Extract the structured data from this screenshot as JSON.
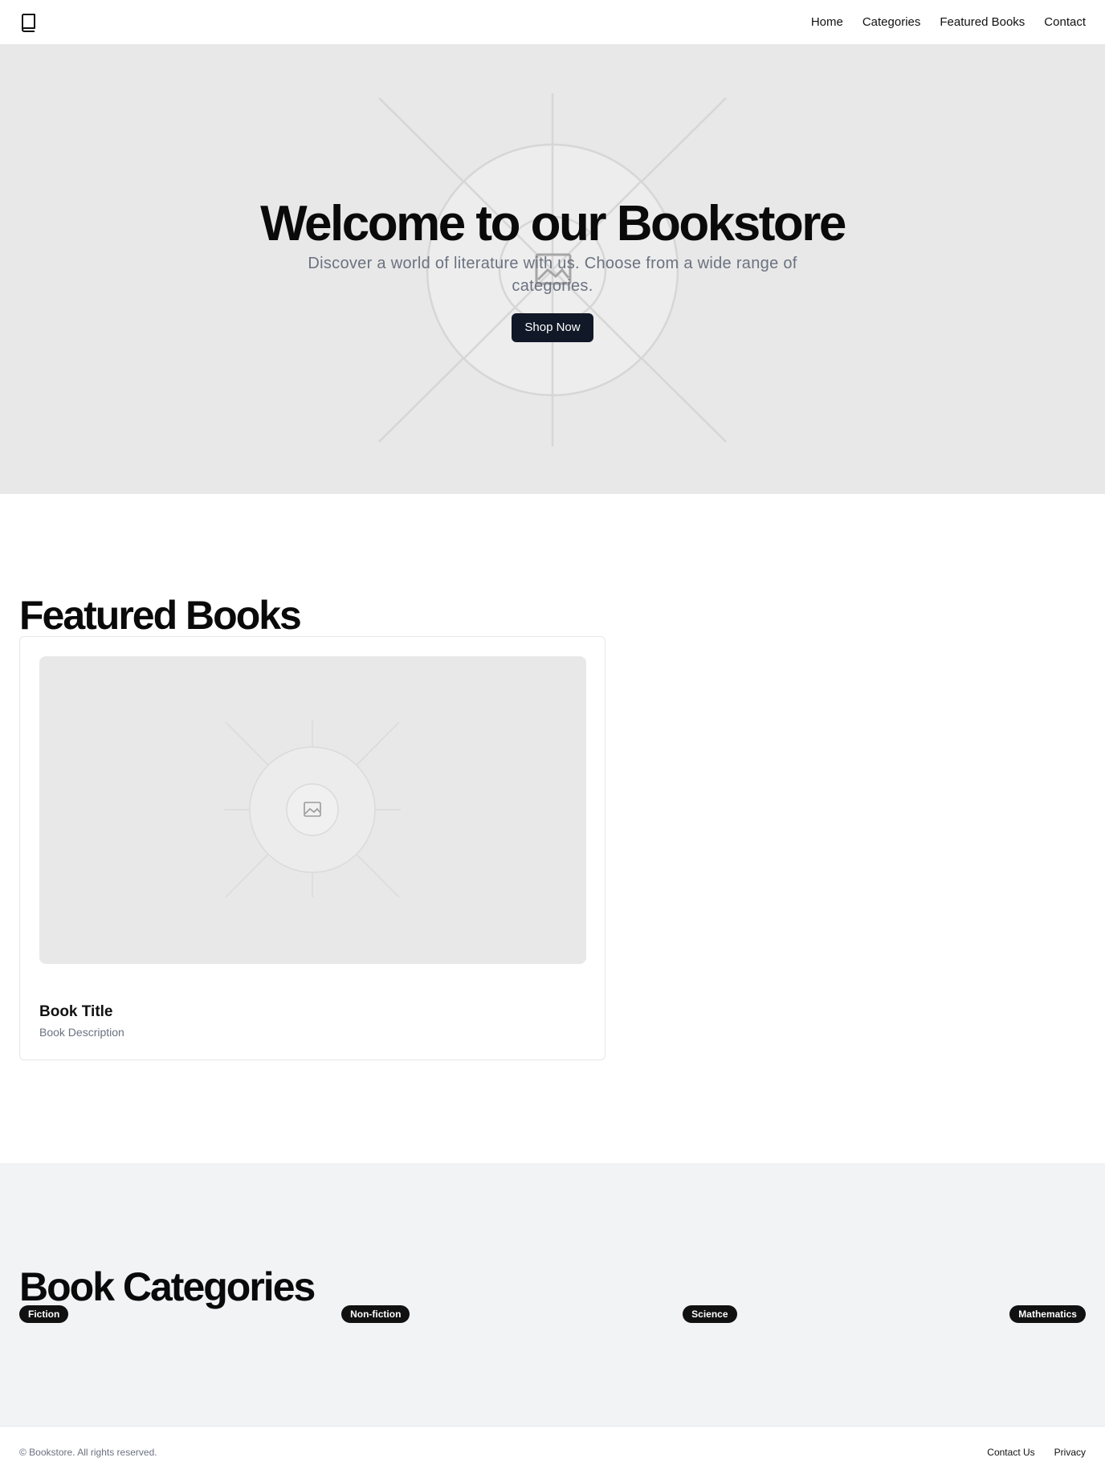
{
  "header": {
    "logo_icon": "book-icon",
    "nav": [
      "Home",
      "Categories",
      "Featured Books",
      "Contact"
    ]
  },
  "hero": {
    "title": "Welcome to our Bookstore",
    "subtitle": "Discover a world of literature with us. Choose from a wide range of categories.",
    "cta": "Shop Now",
    "image_icon": "image-placeholder-icon"
  },
  "featured": {
    "heading": "Featured Books",
    "books": [
      {
        "title": "Book Title",
        "description": "Book Description",
        "image_icon": "image-placeholder-icon"
      }
    ]
  },
  "categories": {
    "heading": "Book Categories",
    "items": [
      "Fiction",
      "Non-fiction",
      "Science",
      "Mathematics"
    ]
  },
  "footer": {
    "copyright": "© Bookstore. All rights reserved.",
    "links": [
      "Contact Us",
      "Privacy"
    ]
  },
  "colors": {
    "primary_button": "#111827",
    "placeholder_bg": "#e8e8e8",
    "section_alt_bg": "#f2f3f5",
    "muted_text": "#6b7280"
  }
}
